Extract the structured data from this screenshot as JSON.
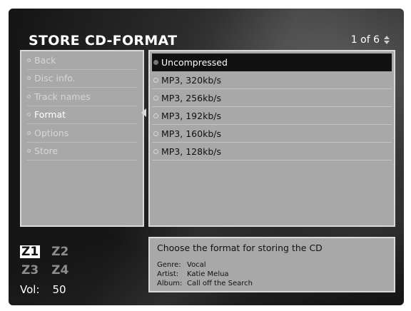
{
  "header": {
    "title": "STORE CD-FORMAT",
    "pager": "1 of 6"
  },
  "menu": {
    "items": [
      {
        "label": "Back",
        "active": false
      },
      {
        "label": "Disc info.",
        "active": false
      },
      {
        "label": "Track names",
        "active": false
      },
      {
        "label": "Format",
        "active": true
      },
      {
        "label": "Options",
        "active": false
      },
      {
        "label": "Store",
        "active": false
      }
    ]
  },
  "formats": {
    "items": [
      {
        "label": "Uncompressed",
        "selected": true
      },
      {
        "label": "MP3, 320kb/s",
        "selected": false
      },
      {
        "label": "MP3, 256kb/s",
        "selected": false
      },
      {
        "label": "MP3, 192kb/s",
        "selected": false
      },
      {
        "label": "MP3, 160kb/s",
        "selected": false
      },
      {
        "label": "MP3, 128kb/s",
        "selected": false
      }
    ]
  },
  "zones": {
    "z1": "Z1",
    "z2": "Z2",
    "z3": "Z3",
    "z4": "Z4",
    "active": "Z1"
  },
  "volume": {
    "label": "Vol:",
    "value": "50"
  },
  "info": {
    "message": "Choose the format for storing the CD",
    "genre_label": "Genre:",
    "genre": "Vocal",
    "artist_label": "Artist:",
    "artist": "Katie Melua",
    "album_label": "Album:",
    "album": "Call off the Search"
  }
}
